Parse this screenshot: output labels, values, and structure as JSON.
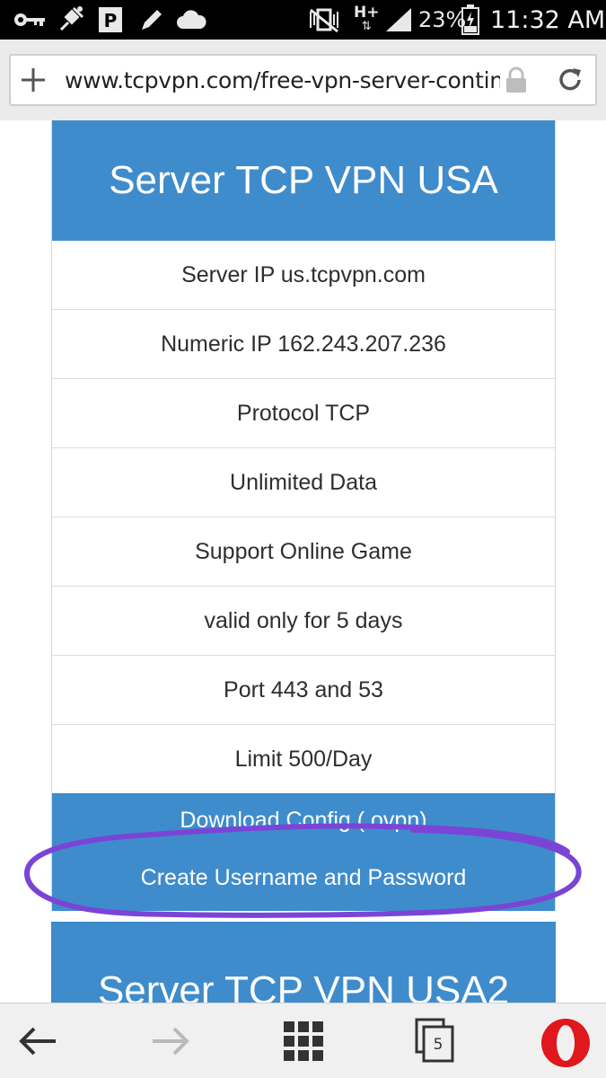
{
  "status_bar": {
    "battery": "23%",
    "network": "H+",
    "time": "11:32 AM"
  },
  "browser": {
    "url": "www.tcpvpn.com/free-vpn-server-continent-america"
  },
  "card": {
    "title": "Server TCP VPN USA",
    "rows": [
      "Server IP us.tcpvpn.com",
      "Numeric IP 162.243.207.236",
      "Protocol TCP",
      "Unlimited Data",
      "Support Online Game",
      "valid only for 5 days",
      "Port 443 and 53",
      "Limit 500/Day"
    ],
    "download_label": "Download Config (.ovpn)",
    "create_label": "Create Username and Password"
  },
  "next_card": {
    "title": "Server TCP VPN USA2"
  },
  "bottom_nav": {
    "tab_count": "5"
  },
  "colors": {
    "accent": "#3f8ccc",
    "annotation": "#7a45d6",
    "opera": "#e0171d"
  }
}
